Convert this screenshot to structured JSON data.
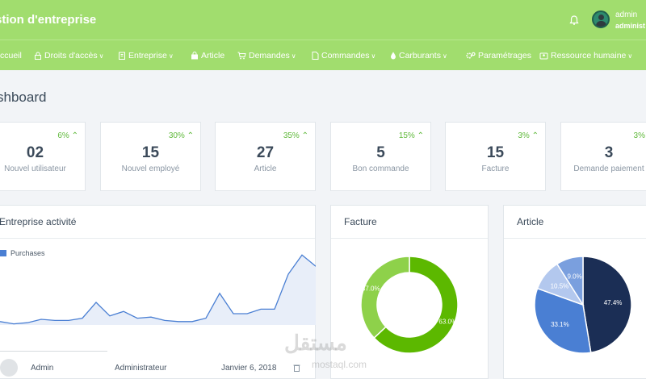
{
  "header": {
    "app_title": "stion d'entreprise",
    "user_name": "admin",
    "user_role": "administ",
    "icons": {
      "bell": "bell-icon",
      "avatar": "user-avatar"
    }
  },
  "nav": {
    "items": [
      {
        "label": "ccueil",
        "icon": "home-icon"
      },
      {
        "label": "Droits d'accès",
        "icon": "lock-icon",
        "dropdown": true
      },
      {
        "label": "Entreprise",
        "icon": "building-icon",
        "dropdown": true
      },
      {
        "label": "Article",
        "icon": "bag-icon"
      },
      {
        "label": "Demandes",
        "icon": "cart-icon",
        "dropdown": true
      },
      {
        "label": "Commandes",
        "icon": "file-icon",
        "dropdown": true
      },
      {
        "label": "Carburants",
        "icon": "droplet-icon",
        "dropdown": true
      },
      {
        "label": "Paramétrages",
        "icon": "cogs-icon"
      },
      {
        "label": "Ressource humaine",
        "icon": "people-icon",
        "dropdown": true
      }
    ]
  },
  "page": {
    "title": "shboard"
  },
  "stats": [
    {
      "pct": "6%",
      "value": "02",
      "label": "Nouvel utilisateur"
    },
    {
      "pct": "30%",
      "value": "15",
      "label": "Nouvel employé"
    },
    {
      "pct": "35%",
      "value": "27",
      "label": "Article"
    },
    {
      "pct": "15%",
      "value": "5",
      "label": "Bon commande"
    },
    {
      "pct": "3%",
      "value": "15",
      "label": "Facture"
    },
    {
      "pct": "3%",
      "value": "3",
      "label": "Demande paiement"
    }
  ],
  "panels": {
    "activity_title": "Entreprise activité",
    "facture_title": "Facture",
    "article_title": "Article"
  },
  "table_row": {
    "name": "Admin",
    "role": "Administrateur",
    "date": "Janvier 6, 2018"
  },
  "watermark": {
    "main": "مستقل",
    "sub": "mostaql.com"
  },
  "colors": {
    "brand_green": "#a1dd6e",
    "pct_green": "#5fb93a",
    "line_blue": "#4a7fd3",
    "pie_navy": "#1b2e55",
    "pie_blue": "#4a7fd3",
    "pie_light": "#b3c8ee",
    "pie_mid": "#7a9fde",
    "donut_dark": "#5cb800",
    "donut_light": "#8ed14a"
  },
  "chart_data": [
    {
      "type": "line",
      "series": [
        {
          "name": "Purchases",
          "values": [
            3,
            1,
            2,
            5,
            4,
            4,
            6,
            20,
            8,
            12,
            6,
            7,
            4,
            3,
            3,
            6,
            28,
            10,
            10,
            14,
            14,
            45,
            62,
            52
          ]
        }
      ],
      "ylim": [
        0,
        70
      ],
      "area": true
    },
    {
      "type": "pie",
      "donut": true,
      "slices": [
        {
          "value": 63.0,
          "label": "63.0%"
        },
        {
          "value": 37.0,
          "label": "37.0%"
        }
      ]
    },
    {
      "type": "pie",
      "slices": [
        {
          "value": 47.4,
          "label": "47.4%"
        },
        {
          "value": 33.1,
          "label": "33.1%"
        },
        {
          "value": 10.5,
          "label": "10.5%"
        },
        {
          "value": 9.0,
          "label": "9.0%"
        }
      ]
    }
  ]
}
